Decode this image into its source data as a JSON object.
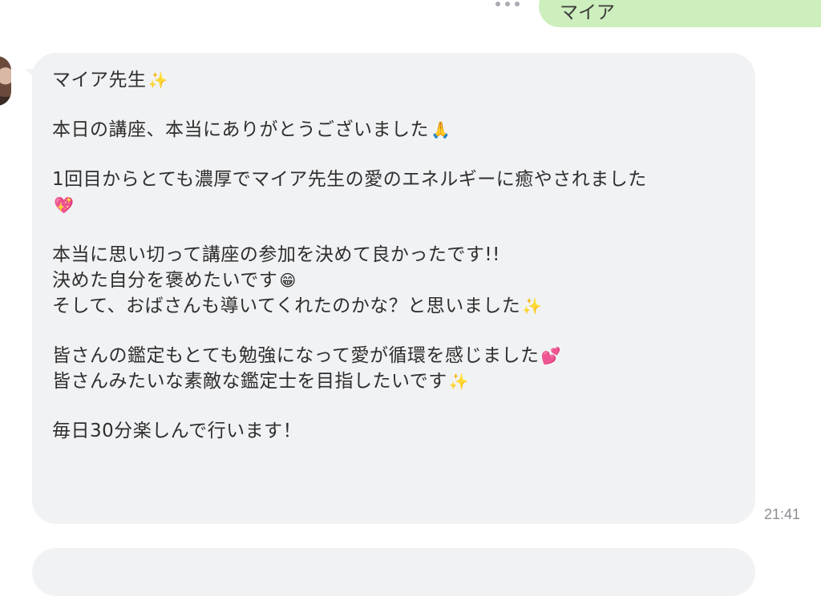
{
  "outgoing": {
    "text": "マイア"
  },
  "incoming": {
    "lines": [
      "マイア先生",
      "本日の講座、本当にありがとうございました",
      "1回目からとても濃厚でマイア先生の愛のエネルギーに癒やされました",
      "",
      "本当に思い切って講座の参加を決めて良かったです!!",
      "決めた自分を褒めたいです",
      "そして、おばさんも導いてくれたのかな？と思いました",
      "皆さんの鑑定もとても勉強になって愛が循環を感じました",
      "皆さんみたいな素敵な鑑定士を目指したいです",
      "毎日30分楽しんで行います！"
    ],
    "emojis": {
      "sparkles": "✨",
      "pray": "🙏",
      "sparkling_heart": "💖",
      "grin": "😁",
      "two_hearts": "💕"
    },
    "time": "21:41"
  }
}
